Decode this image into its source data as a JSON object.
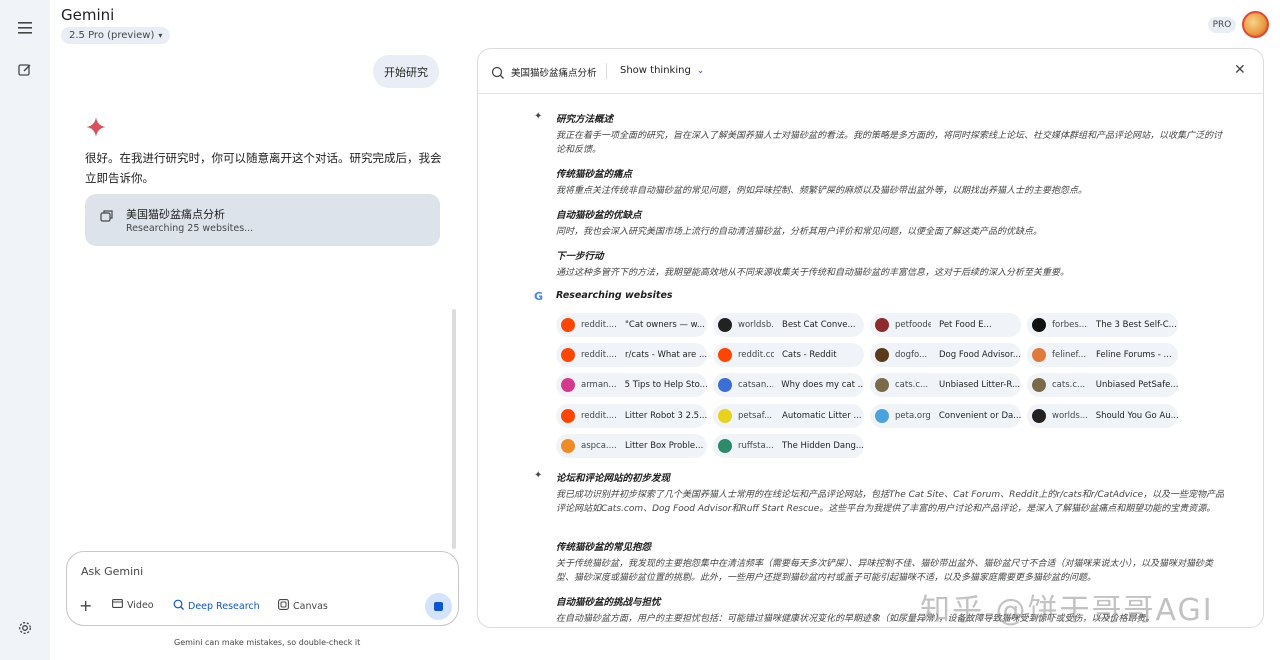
{
  "app": {
    "title": "Gemini",
    "model": "2.5 Pro (preview)",
    "plan_badge": "PRO"
  },
  "chat": {
    "user_message": "开始研究",
    "reply_text": "很好。在我进行研究时，你可以随意离开这个对话。研究完成后，我会立即告诉你。",
    "research_card": {
      "title": "美国猫砂盆痛点分析",
      "status": "Researching 25 websites..."
    }
  },
  "input": {
    "placeholder": "Ask Gemini",
    "tools": {
      "video": "Video",
      "deep_research": "Deep Research",
      "canvas": "Canvas"
    },
    "disclaimer": "Gemini can make mistakes, so double-check it"
  },
  "panel": {
    "title": "美国猫砂盆痛点分析",
    "thinking_label": "Show thinking",
    "sections": [
      {
        "heading": "研究方法概述",
        "body": "我正在着手一项全面的研究，旨在深入了解美国养猫人士对猫砂盆的看法。我的策略是多方面的，将同时探索线上论坛、社交媒体群组和产品评论网站，以收集广泛的讨论和反馈。"
      },
      {
        "heading": "传统猫砂盆的痛点",
        "body": "我将重点关注传统非自动猫砂盆的常见问题，例如异味控制、频繁铲屎的麻烦以及猫砂带出盆外等，以期找出养猫人士的主要抱怨点。"
      },
      {
        "heading": "自动猫砂盆的优缺点",
        "body": "同时，我也会深入研究美国市场上流行的自动清洁猫砂盆，分析其用户评价和常见问题，以便全面了解这类产品的优缺点。"
      },
      {
        "heading": "下一步行动",
        "body": "通过这种多管齐下的方法，我期望能高效地从不同来源收集关于传统和自动猫砂盆的丰富信息，这对于后续的深入分析至关重要。"
      }
    ],
    "websites_heading": "Researching websites",
    "sites": [
      {
        "site": "reddit....",
        "title": "\"Cat owners — w...",
        "color": "#ff4500"
      },
      {
        "site": "worldsb...",
        "title": "Best Cat Conve...",
        "color": "#222222"
      },
      {
        "site": "petfoodexpe...",
        "title": "Pet Food E...",
        "color": "#8e2a2a"
      },
      {
        "site": "forbes....",
        "title": "The 3 Best Self-C...",
        "color": "#111111"
      },
      {
        "site": "reddit....",
        "title": "r/cats - What are ...",
        "color": "#ff4500"
      },
      {
        "site": "reddit.com",
        "title": "Cats - Reddit",
        "color": "#ff4500"
      },
      {
        "site": "dogfo...",
        "title": "Dog Food Advisor...",
        "color": "#5b3a1a"
      },
      {
        "site": "felinef...",
        "title": "Feline Forums - ...",
        "color": "#e07a3a"
      },
      {
        "site": "arman...",
        "title": "5 Tips to Help Sto...",
        "color": "#d63a8f"
      },
      {
        "site": "catsan...",
        "title": "Why does my cat ...",
        "color": "#3a6fd6"
      },
      {
        "site": "cats.c...",
        "title": "Unbiased Litter-R...",
        "color": "#7a6a4a"
      },
      {
        "site": "cats.c...",
        "title": "Unbiased PetSafe...",
        "color": "#7a6a4a"
      },
      {
        "site": "reddit....",
        "title": "Litter Robot 3 2.5...",
        "color": "#ff4500"
      },
      {
        "site": "petsaf...",
        "title": "Automatic Litter ...",
        "color": "#e8d21a"
      },
      {
        "site": "peta.org",
        "title": "Convenient or Da...",
        "color": "#4aa3df"
      },
      {
        "site": "worlds...",
        "title": "Should You Go Au...",
        "color": "#222222"
      },
      {
        "site": "aspca....",
        "title": "Litter Box Proble...",
        "color": "#f08a24"
      },
      {
        "site": "ruffsta...",
        "title": "The Hidden Dang...",
        "color": "#2a8a6a"
      }
    ],
    "sections_after": [
      {
        "heading": "论坛和评论网站的初步发现",
        "body": "我已成功识别并初步探索了几个美国养猫人士常用的在线论坛和产品评论网站，包括The Cat Site、Cat Forum、Reddit上的r/cats和r/CatAdvice，以及一些宠物产品评论网站如Cats.com、Dog Food Advisor和Ruff Start Rescue。这些平台为我提供了丰富的用户讨论和产品评论，是深入了解猫砂盆痛点和期望功能的宝贵资源。"
      },
      {
        "heading": "传统猫砂盆的常见抱怨",
        "body": "关于传统猫砂盆，我发现的主要抱怨集中在清洁频率（需要每天多次铲屎）、异味控制不佳、猫砂带出盆外、猫砂盆尺寸不合适（对猫咪来说太小），以及猫咪对猫砂类型、猫砂深度或猫砂盆位置的挑剔。此外，一些用户还提到猫砂盆内衬或盖子可能引起猫咪不适，以及多猫家庭需要更多猫砂盆的问题。"
      },
      {
        "heading": "自动猫砂盆的挑战与担忧",
        "body": "在自动猫砂盆方面，用户的主要担忧包括：可能错过猫咪健康状况变化的早期迹象（如尿量异常），设备故障导致猫咪受到惊吓或受伤，以及价格昂贵。"
      }
    ],
    "watermark": "知乎 @饼干哥哥AGI"
  }
}
